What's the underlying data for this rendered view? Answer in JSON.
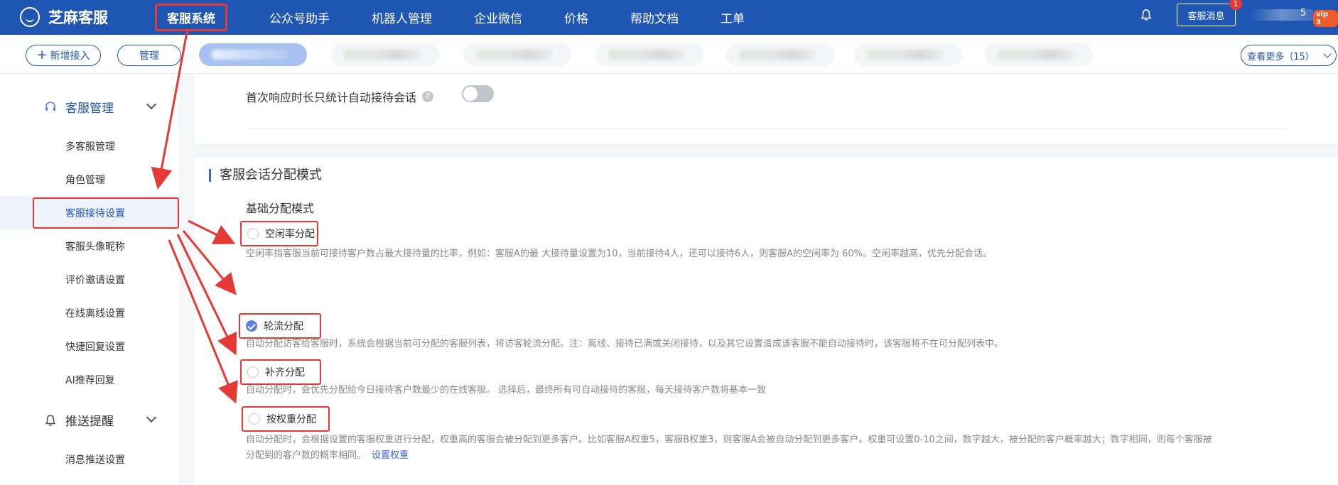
{
  "app": {
    "name": "芝麻客服"
  },
  "nav": {
    "items": [
      {
        "label": "客服系统",
        "active": true
      },
      {
        "label": "公众号助手"
      },
      {
        "label": "机器人管理"
      },
      {
        "label": "企业微信"
      },
      {
        "label": "价格"
      },
      {
        "label": "帮助文档"
      },
      {
        "label": "工单"
      }
    ]
  },
  "header": {
    "message_button": "客服消息",
    "message_count": "1",
    "account_suffix": "5",
    "vip_badge": "vip 3"
  },
  "tabs": {
    "add_label": "新增接入",
    "manage_label": "管理",
    "see_more": "查看更多（15）"
  },
  "sidebar": {
    "groups": [
      {
        "label": "客服管理",
        "icon": "headset-icon",
        "items": [
          {
            "label": "多客服管理"
          },
          {
            "label": "角色管理"
          },
          {
            "label": "客服接待设置",
            "active": true
          },
          {
            "label": "客服头像昵称"
          },
          {
            "label": "评价邀请设置"
          },
          {
            "label": "在线离线设置"
          },
          {
            "label": "快捷回复设置"
          },
          {
            "label": "AI推荐回复"
          }
        ]
      },
      {
        "label": "推送提醒",
        "icon": "bell-icon",
        "items": [
          {
            "label": "消息推送设置"
          }
        ]
      }
    ]
  },
  "main": {
    "first_response": {
      "label": "首次响应时长只统计自动接待会话",
      "help": "?",
      "enabled": false
    },
    "section_title": "客服会话分配模式",
    "sub_title": "基础分配模式",
    "modes": [
      {
        "label": "空闲率分配",
        "selected": false,
        "desc": "空闲率指客服当前可接待客户数占最大接待量的比率，例如：客服A的最 大接待量设置为10，当前接待4人，还可以接待6人，则客服A的空闲率为 60%。空闲率越高，优先分配会话。"
      },
      {
        "label": "轮流分配",
        "selected": true,
        "desc": "自动分配访客给客服时，系统会根据当前可分配的客服列表，将访客轮流分配。注：离线、接待已满或关闭接待，以及其它设置造成该客服不能自动接待时，该客服将不在可分配列表中。"
      },
      {
        "label": "补齐分配",
        "selected": false,
        "desc": "自动分配时，会优先分配给今日接待客户数最少的在线客服。 选择后，最终所有可自动接待的客服，每天接待客户数将基本一致"
      },
      {
        "label": "按权重分配",
        "selected": false,
        "desc_line1": "自动分配时，会根据设置的客服权重进行分配，权重高的客服会被分配到更多客户。比如客服A权重5，客服B权重3，则客服A会被自动分配到更多客户。权重可设置0-10之间，数字越大，被分配的客户概率越大；数字相同，则每个客服被",
        "desc_line2": "分配到的客户数的概率相同。",
        "link": "设置权重"
      }
    ]
  },
  "colors": {
    "brand": "#1f55b3",
    "accent": "#3a64d8",
    "annotation": "#e53935"
  }
}
